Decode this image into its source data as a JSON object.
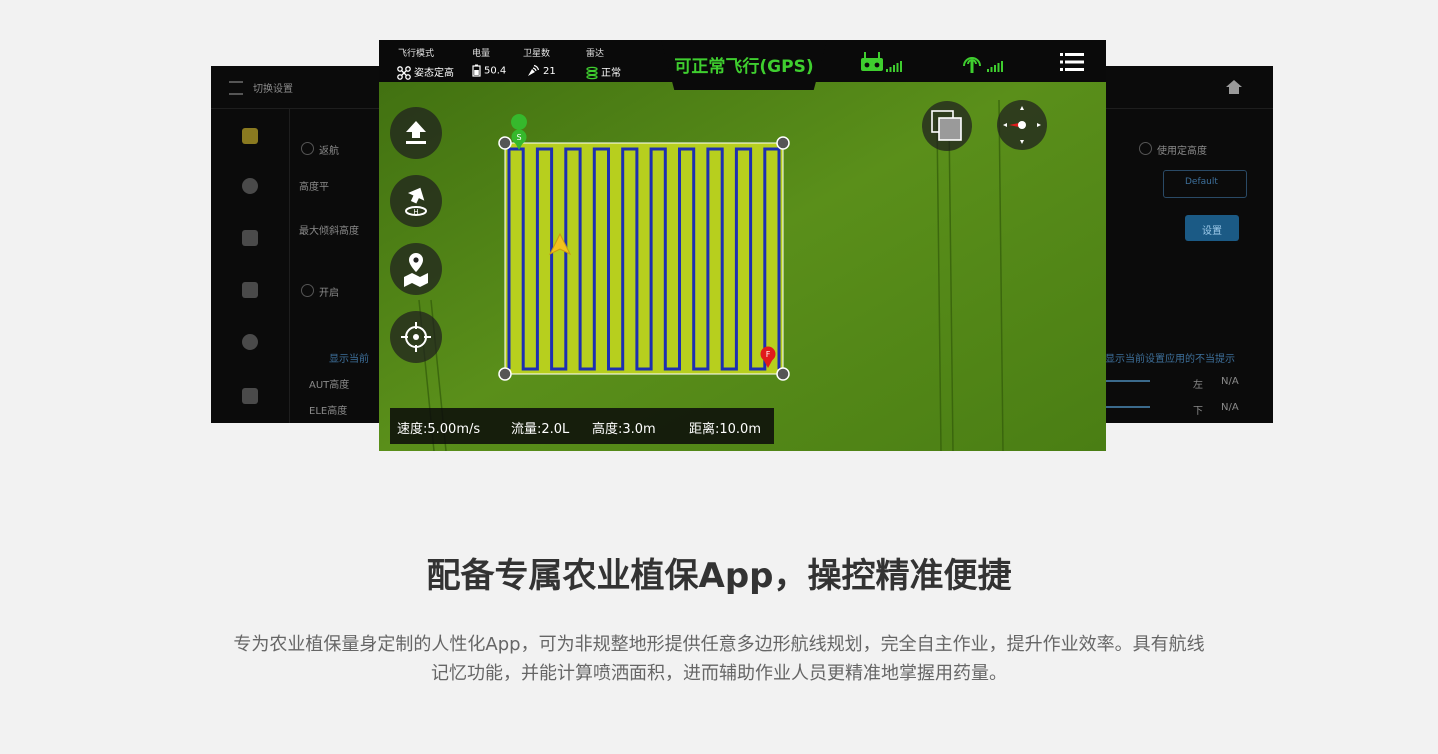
{
  "colors": {
    "accent_green": "#3fce2f",
    "route_blue": "#1d2fb0",
    "field_yellow": "#b9cf1f",
    "marker_red": "#e11b1b"
  },
  "status_bar": {
    "flight_mode_label": "飞行模式",
    "flight_mode_value": "姿态定高",
    "battery_label": "电量",
    "battery_value": "50.4",
    "satellites_label": "卫星数",
    "satellites_value": "21",
    "radar_label": "雷达",
    "radar_value": "正常",
    "flight_status": "可正常飞行(GPS)",
    "icons": [
      "drone-icon",
      "battery-icon",
      "satellite-icon",
      "radar-icon",
      "remote-controller-icon",
      "signal-bars-icon",
      "rtk-signal-icon",
      "menu-icon"
    ]
  },
  "map": {
    "start_marker": "S",
    "end_marker": "F",
    "left_buttons": [
      "takeoff-icon",
      "return-home-icon",
      "map-location-icon",
      "target-locate-icon"
    ],
    "right_buttons": [
      "layers-icon",
      "compass-icon"
    ]
  },
  "telemetry": {
    "speed": "速度:5.00m/s",
    "flow": "流量:2.0L",
    "altitude": "高度:3.0m",
    "distance": "距离:10.0m"
  },
  "headline": "配备专属农业植保App，操控精准便捷",
  "description_line1": "专为农业植保量身定制的人性化App，可为非规整地形提供任意多边形航线规划，完全自主作业，提升作业效率。具有航线",
  "description_line2": "记忆功能，并能计算喷洒面积，进而辅助作业人员更精准地掌握用药量。",
  "background_left": {
    "title": "切换设置",
    "items": [
      "返航",
      "高度平",
      "最大倾斜高度",
      "开启",
      "AUT高度",
      "ELE高度"
    ],
    "note": "显示当前"
  },
  "background_right": {
    "items": [
      "使用定高度",
      "Default",
      "设置",
      "N/A",
      "N/A"
    ],
    "axis": [
      "左",
      "下"
    ],
    "note": "显示当前设置应用的不当提示"
  }
}
